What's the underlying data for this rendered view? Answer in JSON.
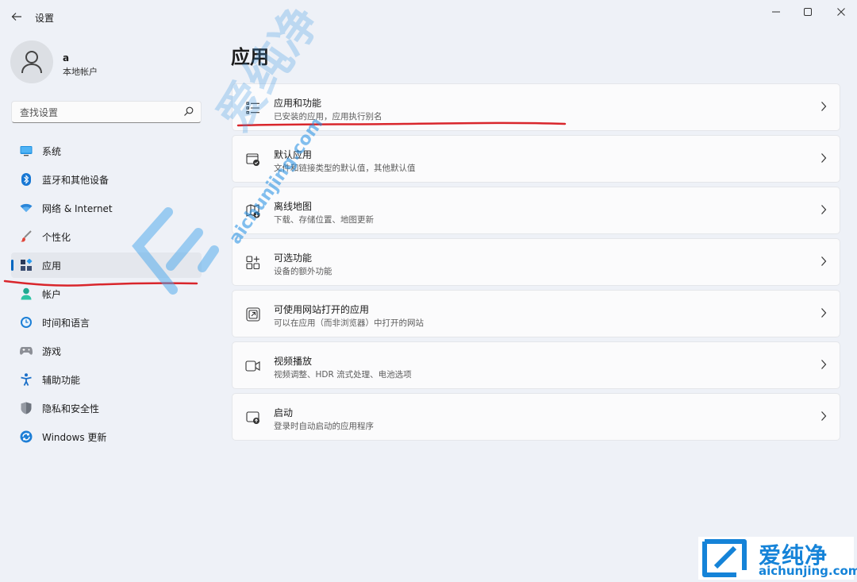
{
  "window": {
    "title": "设置",
    "back_icon": "arrow-left-icon",
    "controls": [
      "minimize-icon",
      "maximize-icon",
      "close-icon"
    ]
  },
  "profile": {
    "name": "a",
    "account_type": "本地帐户"
  },
  "search": {
    "placeholder": "查找设置"
  },
  "sidebar": {
    "items": [
      {
        "label": "系统",
        "icon": "monitor-icon",
        "selected": false
      },
      {
        "label": "蓝牙和其他设备",
        "icon": "bluetooth-icon",
        "selected": false
      },
      {
        "label": "网络 & Internet",
        "icon": "wifi-icon",
        "selected": false
      },
      {
        "label": "个性化",
        "icon": "brush-icon",
        "selected": false
      },
      {
        "label": "应用",
        "icon": "apps-icon",
        "selected": true
      },
      {
        "label": "帐户",
        "icon": "person-icon",
        "selected": false
      },
      {
        "label": "时间和语言",
        "icon": "clock-globe-icon",
        "selected": false
      },
      {
        "label": "游戏",
        "icon": "gamepad-icon",
        "selected": false
      },
      {
        "label": "辅助功能",
        "icon": "accessibility-icon",
        "selected": false
      },
      {
        "label": "隐私和安全性",
        "icon": "shield-icon",
        "selected": false
      },
      {
        "label": "Windows 更新",
        "icon": "update-icon",
        "selected": false
      }
    ]
  },
  "main": {
    "title": "应用",
    "cards": [
      {
        "title": "应用和功能",
        "subtitle": "已安装的应用，应用执行别名",
        "icon": "list-icon"
      },
      {
        "title": "默认应用",
        "subtitle": "文件和链接类型的默认值，其他默认值",
        "icon": "default-apps-icon"
      },
      {
        "title": "离线地图",
        "subtitle": "下载、存储位置、地图更新",
        "icon": "map-download-icon"
      },
      {
        "title": "可选功能",
        "subtitle": "设备的额外功能",
        "icon": "grid-add-icon"
      },
      {
        "title": "可使用网站打开的应用",
        "subtitle": "可以在应用（而非浏览器）中打开的网站",
        "icon": "open-link-icon"
      },
      {
        "title": "视频播放",
        "subtitle": "视频调整、HDR 流式处理、电池选项",
        "icon": "video-icon"
      },
      {
        "title": "启动",
        "subtitle": "登录时自动启动的应用程序",
        "icon": "startup-icon"
      }
    ]
  },
  "watermark": {
    "brand_cn": "爱纯净",
    "brand_en": "aichunjing.com",
    "brand_color": "#1583d8"
  },
  "colors": {
    "accent": "#0067c0",
    "annotation": "#d9262c"
  }
}
